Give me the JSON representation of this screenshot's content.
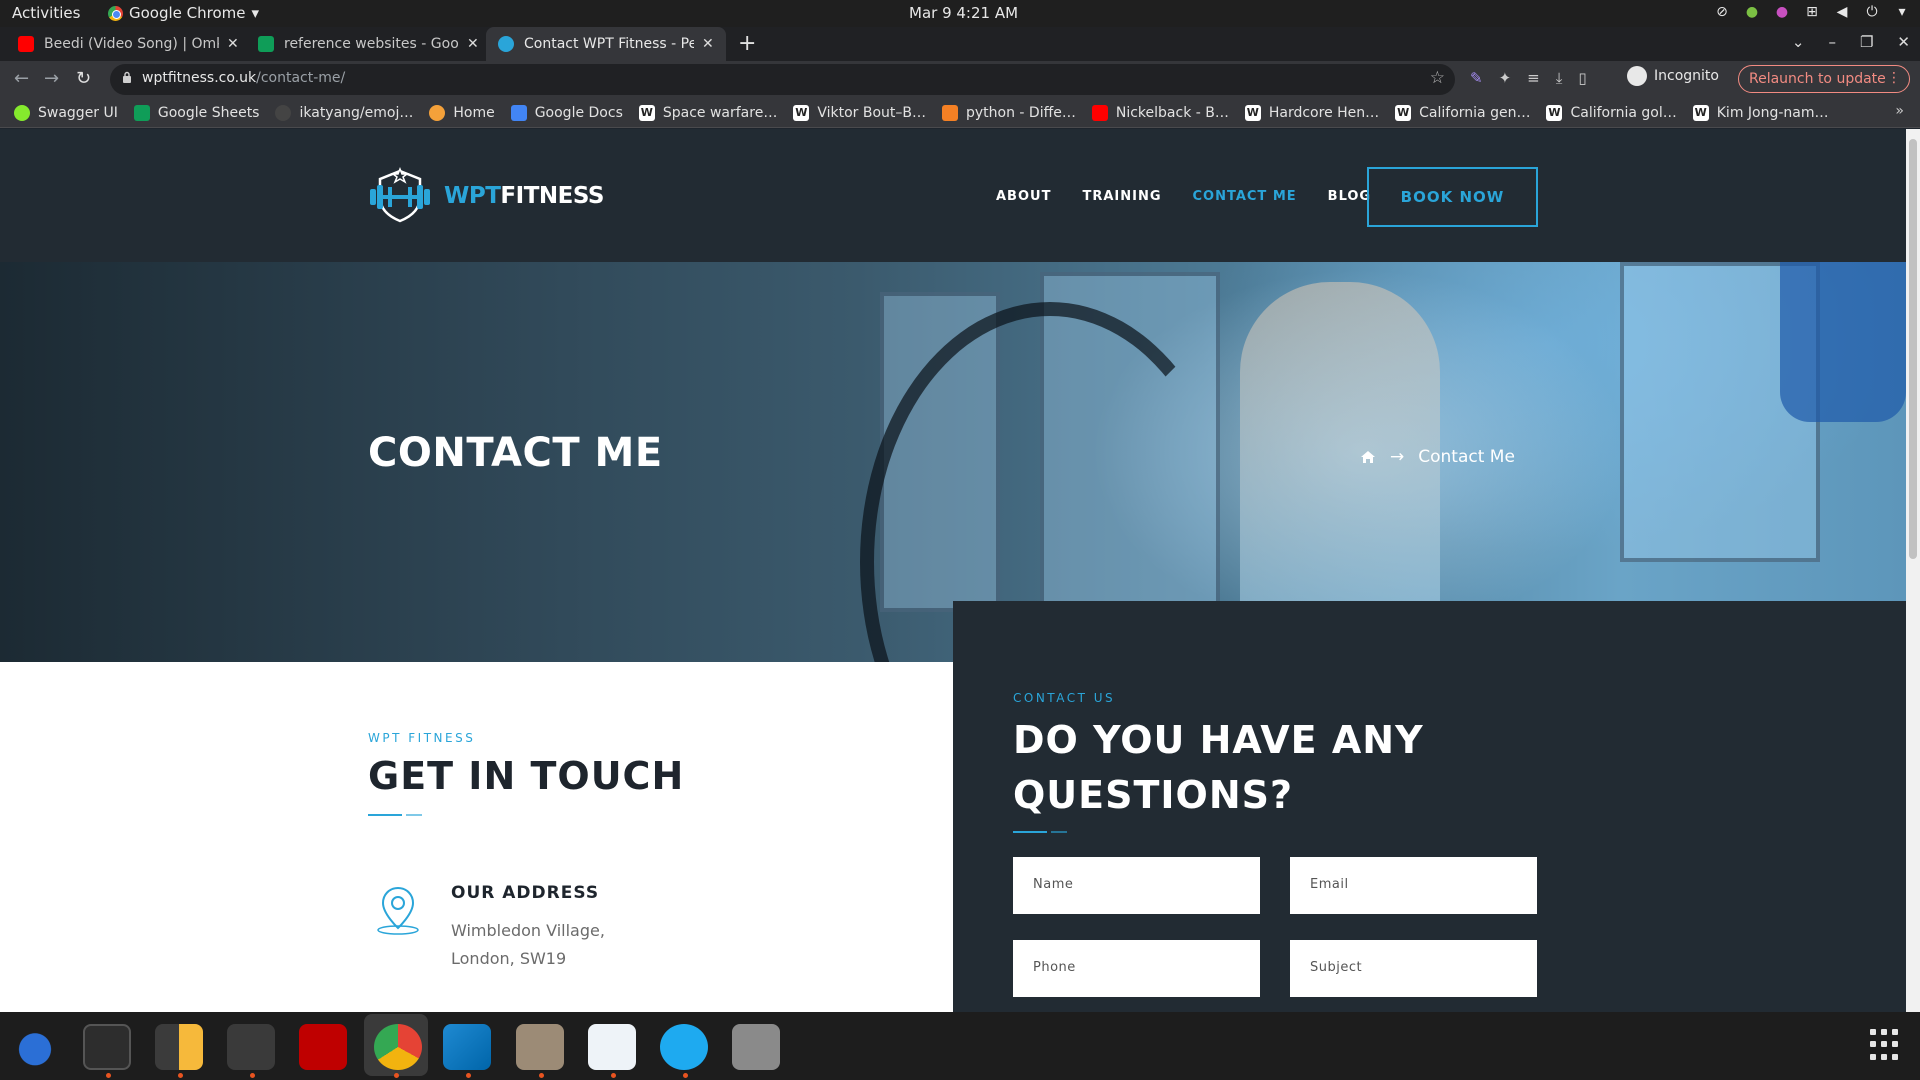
{
  "system": {
    "activities": "Activities",
    "app_name": "Google Chrome",
    "clock": "Mar 9   4:21 AM"
  },
  "tabs": [
    {
      "title": "Beedi (Video Song) | Omk",
      "icon": "youtube-icon"
    },
    {
      "title": "reference websites - Goog",
      "icon": "sheets-icon"
    },
    {
      "title": "Contact WPT Fitness - Per",
      "icon": "wpt-icon",
      "active": true
    }
  ],
  "address_bar": {
    "host": "wptfitness.co.uk",
    "path": "/contact-me/",
    "profile": "Incognito",
    "relaunch": "Relaunch to update"
  },
  "bookmarks": [
    {
      "label": "Swagger UI",
      "icon": "swagger-icon"
    },
    {
      "label": "Google Sheets",
      "icon": "sheets-icon"
    },
    {
      "label": "ikatyang/emoj…",
      "icon": "github-icon"
    },
    {
      "label": "Home",
      "icon": "home-icon"
    },
    {
      "label": "Google Docs",
      "icon": "docs-icon"
    },
    {
      "label": "Space warfare…",
      "icon": "wikipedia-icon"
    },
    {
      "label": "Viktor Bout–B…",
      "icon": "wikipedia-icon"
    },
    {
      "label": "python - Diffe…",
      "icon": "stackoverflow-icon"
    },
    {
      "label": "Nickelback - B…",
      "icon": "youtube-icon"
    },
    {
      "label": "Hardcore Hen…",
      "icon": "wikipedia-icon"
    },
    {
      "label": "California gen…",
      "icon": "wikipedia-icon"
    },
    {
      "label": "California gol…",
      "icon": "wikipedia-icon"
    },
    {
      "label": "Kim Jong-nam…",
      "icon": "wikipedia-icon"
    }
  ],
  "site": {
    "logo_blue": "WPT",
    "logo_white": "FITNESS",
    "nav": [
      "ABOUT",
      "TRAINING",
      "CONTACT ME",
      "BLOG"
    ],
    "book_now": "BOOK NOW",
    "hero_title": "CONTACT ME",
    "breadcrumb_arrow": "→",
    "breadcrumb_current": "Contact Me",
    "left": {
      "kicker": "WPT FITNESS",
      "heading": "GET IN TOUCH",
      "address_label": "OUR ADDRESS",
      "address_line1": "Wimbledon Village,",
      "address_line2": "London, SW19"
    },
    "contact": {
      "kicker": "CONTACT US",
      "heading_line1": "DO YOU HAVE ANY",
      "heading_line2": "QUESTIONS?",
      "fields": {
        "name": "Name",
        "email": "Email",
        "phone": "Phone",
        "subject": "Subject"
      }
    }
  },
  "colors": {
    "accent": "#2aa5d9",
    "dark": "#222b33"
  }
}
